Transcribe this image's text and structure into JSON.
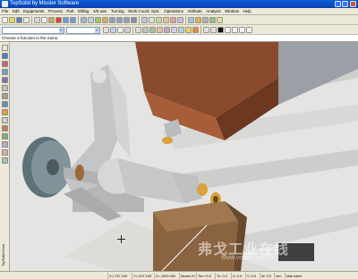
{
  "window": {
    "title": "TopSolid by Missler Software"
  },
  "menu": [
    "File",
    "Edit",
    "Equipments",
    "Process",
    "Part",
    "Milling",
    "4/5 axis",
    "Turning",
    "Work Coord. Syst.",
    "Operations",
    "Attribute",
    "Analysis",
    "Window",
    "Help"
  ],
  "prompt": "Choose a function in the menu",
  "side_label": "TopSolid Cam",
  "status": {
    "x": "X=-747.100",
    "y": "Y=-297.100",
    "z": "Z=-1000.000",
    "mode": "Mode=XI",
    "tol": "Tol=+3.5",
    "tu": "Tu: 0.0",
    "u": "U: 0.0",
    "v": "V: 0.0",
    "w": "W: 0.0",
    "mm": "mm",
    "material": "Mat=steel"
  },
  "watermark": {
    "line1": "弗戈工业在线",
    "line2": "www.vogel.com.cn"
  },
  "colors": {
    "titlebar": "#0b4fc8",
    "chrome": "#ece9d8",
    "viewport": "#e5e6e4",
    "block": "#8a4a2c",
    "brass": "#d9a23a"
  }
}
